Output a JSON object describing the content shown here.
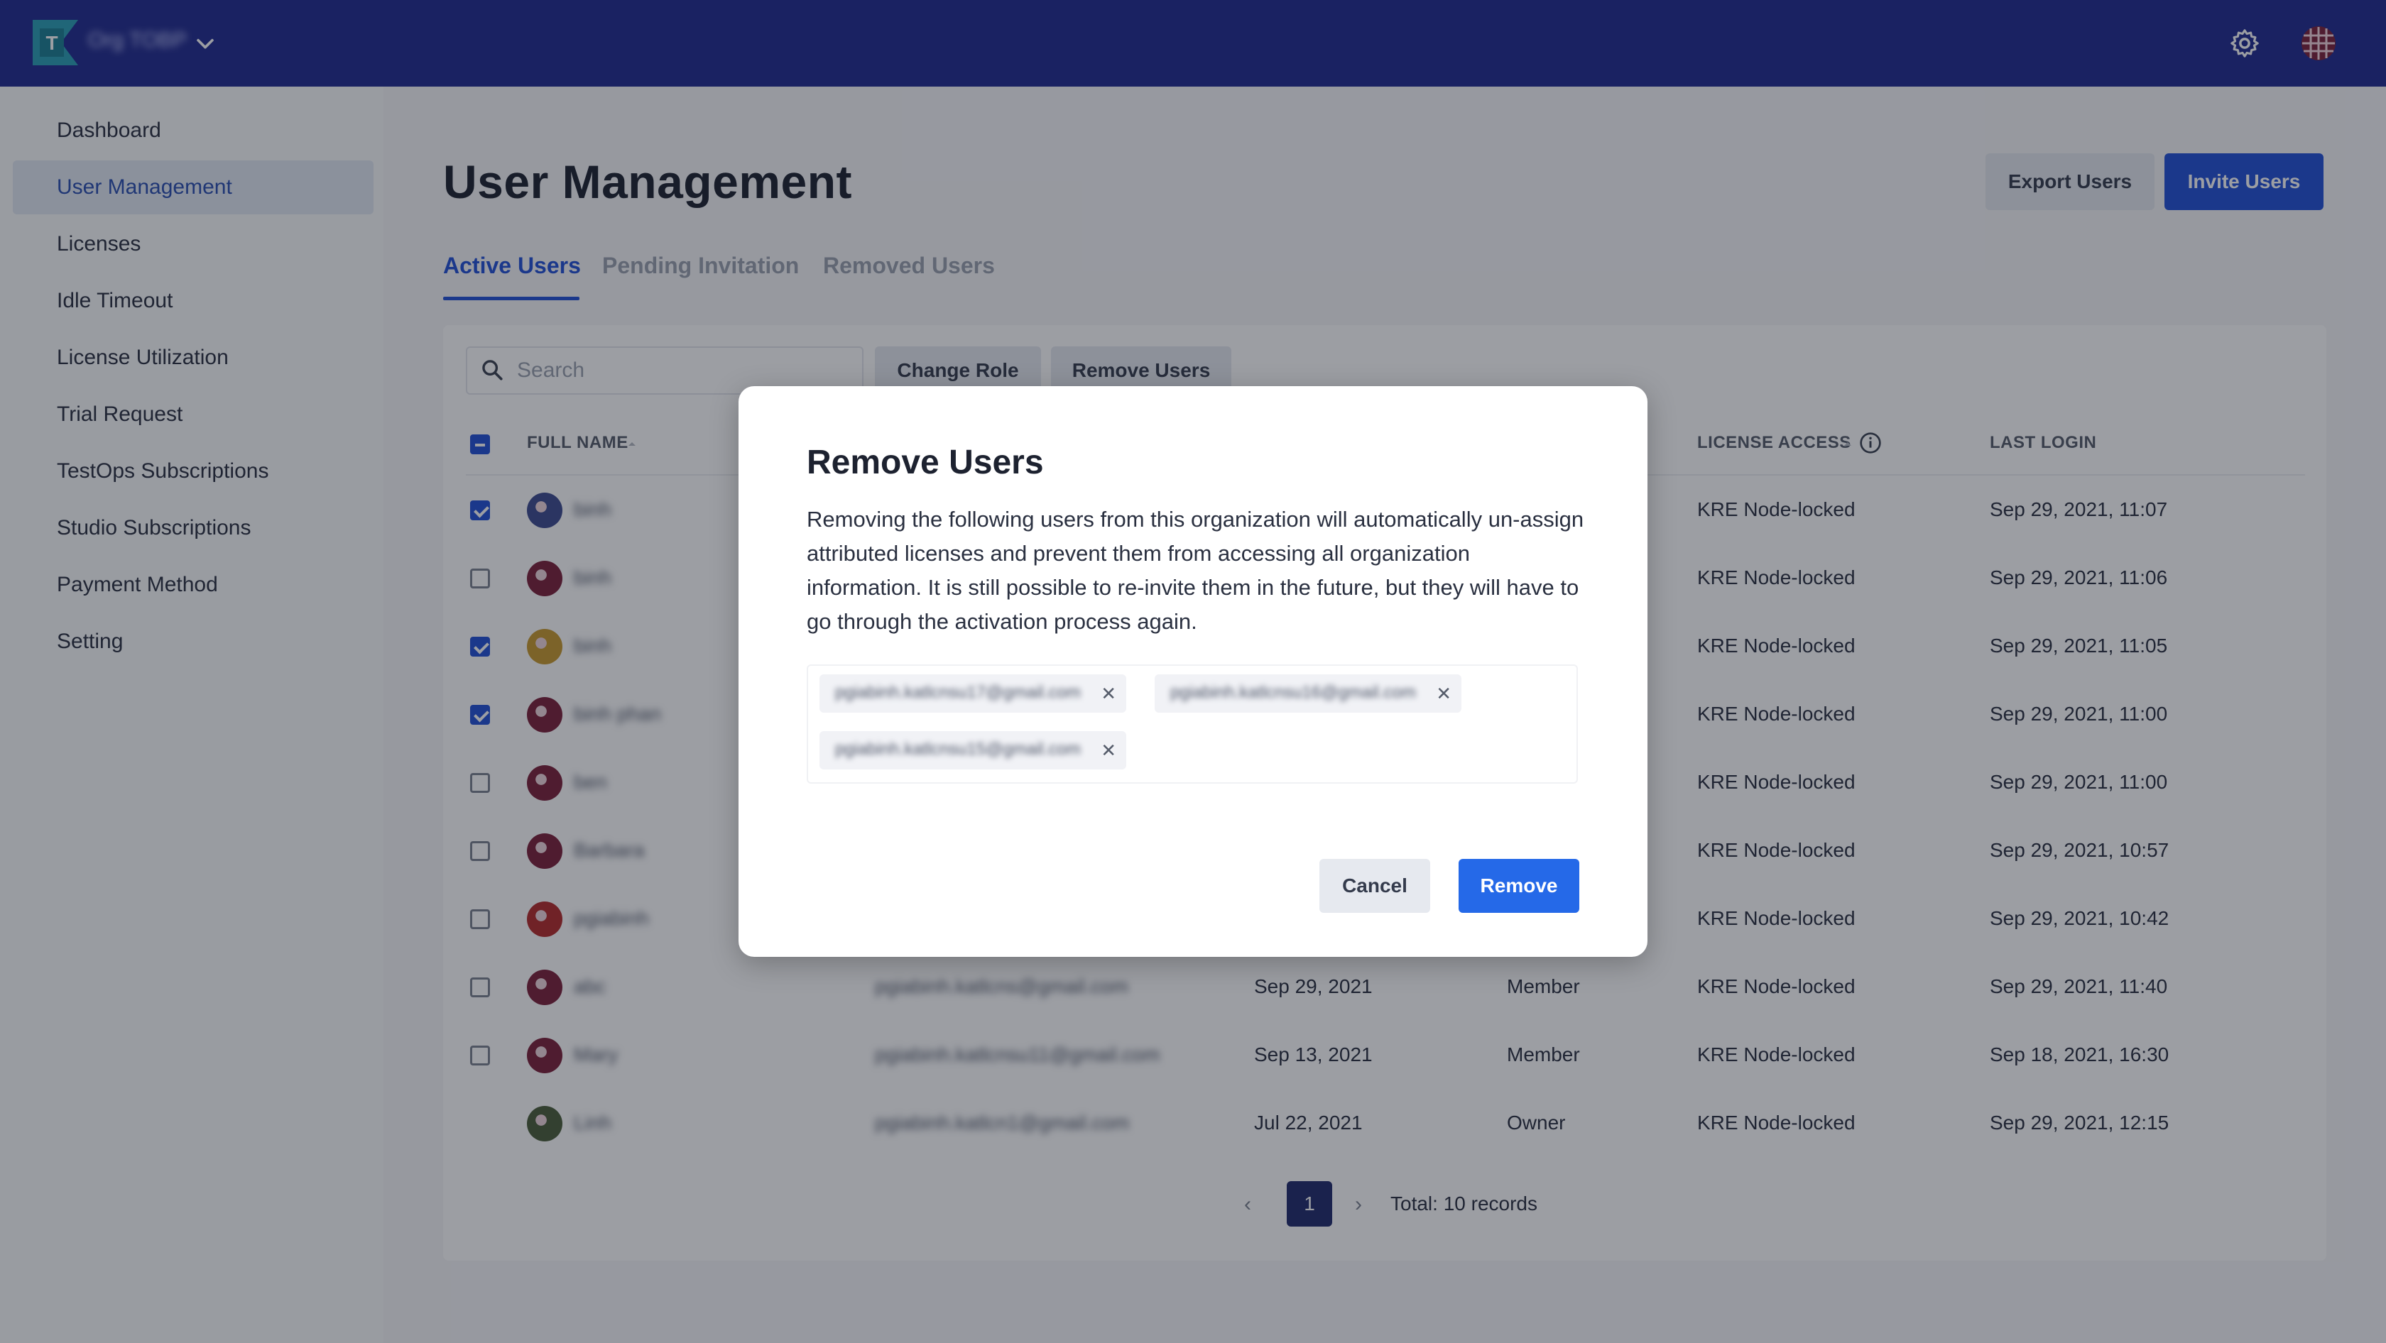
{
  "header": {
    "org_name": "Org TOBP",
    "org_logo_letter": "T",
    "icons": [
      "logo-icon",
      "chevron-down-icon",
      "gear-icon",
      "avatar"
    ]
  },
  "sidebar": {
    "items": [
      {
        "label": "Dashboard"
      },
      {
        "label": "User Management",
        "active": true
      },
      {
        "label": "Licenses"
      },
      {
        "label": "Idle Timeout"
      },
      {
        "label": "License Utilization"
      },
      {
        "label": "Trial Request"
      },
      {
        "label": "TestOps Subscriptions"
      },
      {
        "label": "Studio Subscriptions"
      },
      {
        "label": "Payment Method"
      },
      {
        "label": "Setting"
      }
    ]
  },
  "main": {
    "title": "User Management",
    "export_label": "Export Users",
    "invite_label": "Invite Users",
    "tabs": [
      {
        "label": "Active Users",
        "active": true
      },
      {
        "label": "Pending Invitation"
      },
      {
        "label": "Removed Users"
      }
    ],
    "search": {
      "placeholder": "Search",
      "value": ""
    },
    "change_role_label": "Change Role",
    "remove_users_label": "Remove Users",
    "columns": {
      "full_name": "FULL NAME",
      "license_access": "LICENSE ACCESS",
      "last_login": "LAST LOGIN"
    },
    "rows": [
      {
        "checked": true,
        "name": "binh",
        "email": "",
        "joined": "",
        "role": "",
        "license": "KRE Node-locked",
        "last_login": "Sep 29, 2021, 11:07"
      },
      {
        "checked": false,
        "name": "binh",
        "email": "",
        "joined": "",
        "role": "",
        "license": "KRE Node-locked",
        "last_login": "Sep 29, 2021, 11:06"
      },
      {
        "checked": true,
        "name": "binh",
        "email": "",
        "joined": "",
        "role": "",
        "license": "KRE Node-locked",
        "last_login": "Sep 29, 2021, 11:05"
      },
      {
        "checked": true,
        "name": "binh phan",
        "email": "",
        "joined": "",
        "role": "",
        "license": "KRE Node-locked",
        "last_login": "Sep 29, 2021, 11:00"
      },
      {
        "checked": false,
        "name": "ben",
        "email": "",
        "joined": "",
        "role": "",
        "license": "KRE Node-locked",
        "last_login": "Sep 29, 2021, 11:00"
      },
      {
        "checked": false,
        "name": "Barbara",
        "email": "",
        "joined": "",
        "role": "",
        "license": "KRE Node-locked",
        "last_login": "Sep 29, 2021, 10:57"
      },
      {
        "checked": false,
        "name": "pgiabinh",
        "email": "",
        "joined": "",
        "role": "",
        "license": "KRE Node-locked",
        "last_login": "Sep 29, 2021, 10:42"
      },
      {
        "checked": false,
        "name": "abc",
        "email": "pgiabinh.katlcns@gmail.com",
        "joined": "Sep 29, 2021",
        "role": "Member",
        "license": "KRE Node-locked",
        "last_login": "Sep 29, 2021, 11:40"
      },
      {
        "checked": false,
        "name": "Mary",
        "email": "pgiabinh.katlcnsu11@gmail.com",
        "joined": "Sep 13, 2021",
        "role": "Member",
        "license": "KRE Node-locked",
        "last_login": "Sep 18, 2021, 16:30"
      },
      {
        "checked": null,
        "name": "Linh",
        "email": "pgiabinh.katlcn1@gmail.com",
        "joined": "Jul 22, 2021",
        "role": "Owner",
        "license": "KRE Node-locked",
        "last_login": "Sep 29, 2021, 12:15"
      }
    ],
    "pagination": {
      "prev": "‹",
      "current_page": "1",
      "next": "›",
      "total": "Total: 10 records"
    }
  },
  "modal": {
    "title": "Remove Users",
    "body": "Removing the following users from this organization will automatically un-assign attributed licenses and prevent them from accessing all organization information. It is still possible to re-invite them in the future, but they will have to go through the activation process again.",
    "chips": [
      {
        "email": "pgiabinh.katlcnsu17@gmail.com"
      },
      {
        "email": "pgiabinh.katlcnsu16@gmail.com"
      },
      {
        "email": "pgiabinh.katlcnsu15@gmail.com"
      }
    ],
    "chip_close": "✕",
    "cancel_label": "Cancel",
    "remove_label": "Remove"
  },
  "colors": {
    "topbar": "#202a8f",
    "primary": "#2250d6",
    "modal_primary": "#2569e8"
  }
}
